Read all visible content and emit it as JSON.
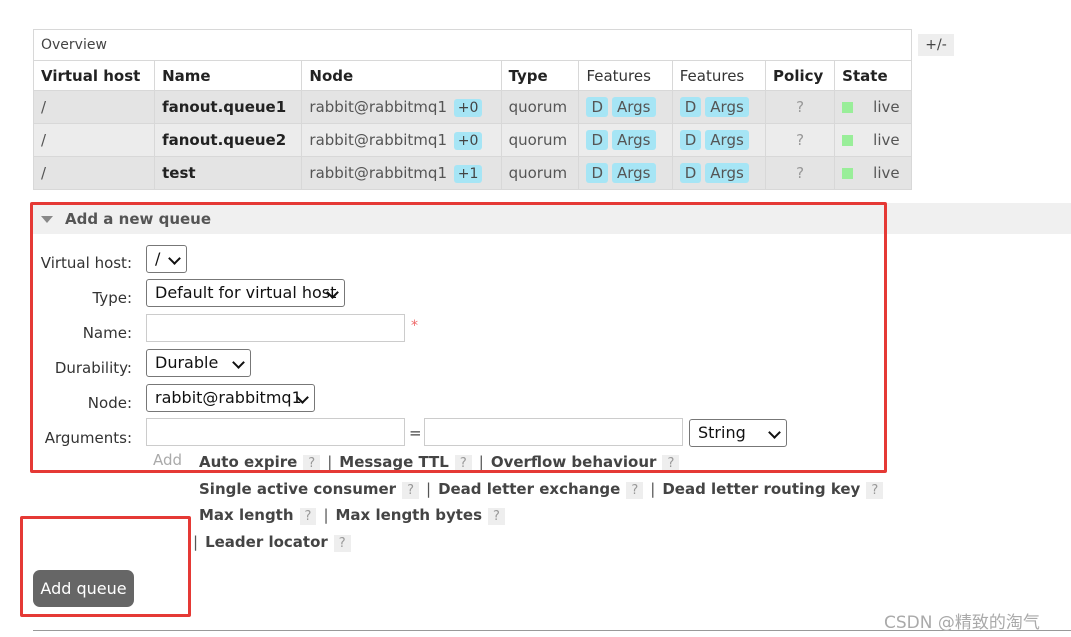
{
  "table": {
    "overview_label": "Overview",
    "plus_minus": "+/-",
    "headers": [
      "Virtual host",
      "Name",
      "Node",
      "Type",
      "Features",
      "Features",
      "Policy",
      "State"
    ],
    "rows": [
      {
        "vhost": "/",
        "name": "fanout.queue1",
        "node": "rabbit@rabbitmq1",
        "node_plus": "+0",
        "type": "quorum",
        "feat1": [
          "D",
          "Args"
        ],
        "feat2": [
          "D",
          "Args"
        ],
        "policy": "?",
        "state": "live"
      },
      {
        "vhost": "/",
        "name": "fanout.queue2",
        "node": "rabbit@rabbitmq1",
        "node_plus": "+0",
        "type": "quorum",
        "feat1": [
          "D",
          "Args"
        ],
        "feat2": [
          "D",
          "Args"
        ],
        "policy": "?",
        "state": "live"
      },
      {
        "vhost": "/",
        "name": "test",
        "node": "rabbit@rabbitmq1",
        "node_plus": "+1",
        "type": "quorum",
        "feat1": [
          "D",
          "Args"
        ],
        "feat2": [
          "D",
          "Args"
        ],
        "policy": "?",
        "state": "live"
      }
    ]
  },
  "form": {
    "title": "Add a new queue",
    "vhost_label": "Virtual host:",
    "vhost_value": "/",
    "type_label": "Type:",
    "type_value": "Default for virtual host",
    "name_label": "Name:",
    "name_value": "",
    "required_mark": "*",
    "durability_label": "Durability:",
    "durability_value": "Durable",
    "node_label": "Node:",
    "node_value": "rabbit@rabbitmq1",
    "arguments_label": "Arguments:",
    "equals": "=",
    "arg_type_value": "String",
    "add_link": "Add",
    "help_lines": [
      [
        "Auto expire",
        "Message TTL",
        "Overflow behaviour"
      ],
      [
        "Single active consumer",
        "Dead letter exchange",
        "Dead letter routing key"
      ],
      [
        "Max length",
        "Max length bytes"
      ],
      [
        "Leader locator"
      ]
    ],
    "help_mark": "?",
    "submit_label": "Add queue"
  },
  "watermark": "CSDN @精致的淘气",
  "colors": {
    "highlight_red": "#e53935",
    "tag_blue": "#a6e5f5",
    "live_green": "#99ee99",
    "button_gray": "#666666"
  }
}
